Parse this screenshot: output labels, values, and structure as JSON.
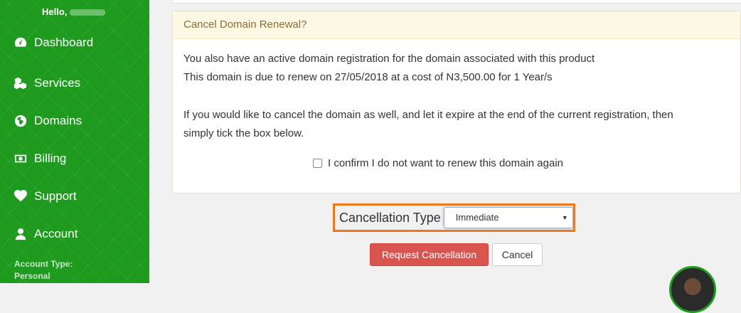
{
  "sidebar": {
    "greeting": "Hello,",
    "items": [
      {
        "label": "Dashboard",
        "icon": "dashboard-icon"
      },
      {
        "label": "Services",
        "icon": "cubes-icon"
      },
      {
        "label": "Domains",
        "icon": "globe-icon"
      },
      {
        "label": "Billing",
        "icon": "money-icon"
      },
      {
        "label": "Support",
        "icon": "heart-icon"
      },
      {
        "label": "Account",
        "icon": "user-icon"
      }
    ],
    "account_type_label": "Account Type:",
    "account_type_value": "Personal"
  },
  "panel": {
    "heading": "Cancel Domain Renewal?",
    "line1": "You also have an active domain registration for the domain associated with this product",
    "line2": "This domain is due to renew on 27/05/2018 at a cost of N3,500.00 for 1 Year/s",
    "line3": "If you would like to cancel the domain as well, and let it expire at the end of the current registration, then",
    "line4": "simply tick the box below.",
    "confirm_label": "I confirm I do not want to renew this domain again",
    "confirm_checked": false
  },
  "cancellation": {
    "label": "Cancellation Type",
    "selected": "Immediate"
  },
  "buttons": {
    "request": "Request Cancellation",
    "cancel": "Cancel"
  },
  "colors": {
    "sidebar": "#1e9a1e",
    "highlight": "#f0771c",
    "danger": "#d9534f",
    "warning_bg": "#fcf8e3"
  }
}
